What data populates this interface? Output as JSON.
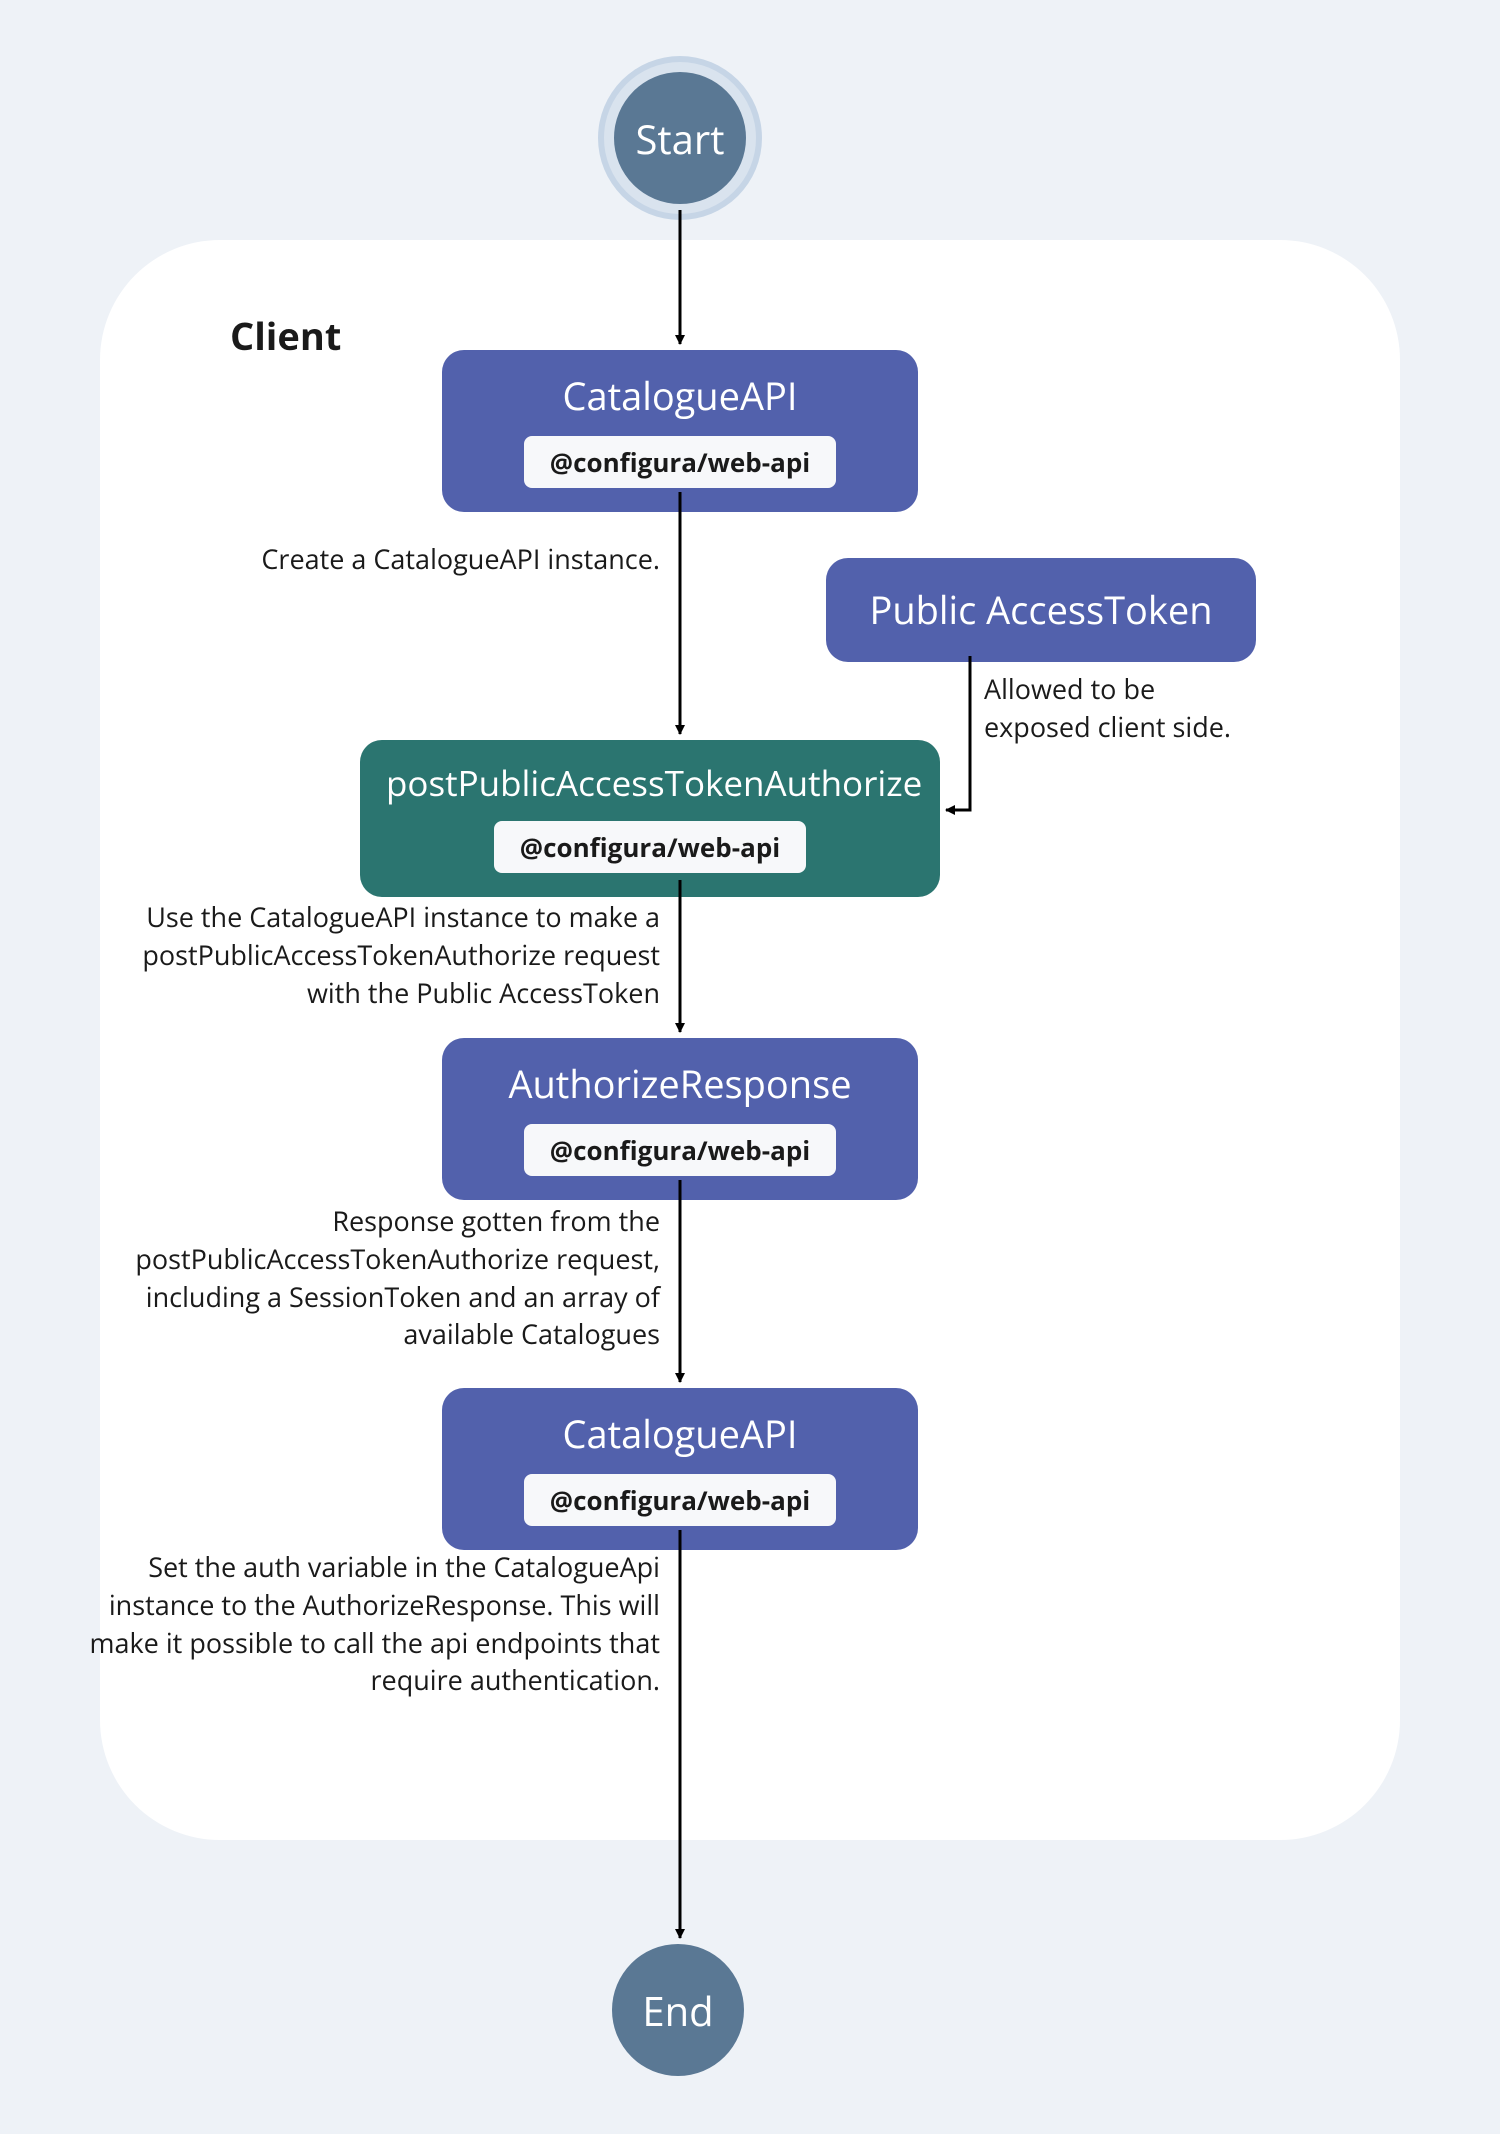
{
  "terminals": {
    "start": "Start",
    "end": "End"
  },
  "client_label": "Client",
  "boxes": {
    "catalogue_api_1": {
      "title": "CatalogueAPI",
      "tag": "@configura/web-api"
    },
    "public_token": {
      "title": "Public AccessToken"
    },
    "post_auth": {
      "title": "postPublicAccessTokenAuthorize",
      "tag": "@configura/web-api"
    },
    "auth_response": {
      "title": "AuthorizeResponse",
      "tag": "@configura/web-api"
    },
    "catalogue_api_2": {
      "title": "CatalogueAPI",
      "tag": "@configura/web-api"
    }
  },
  "captions": {
    "create_instance": "Create a CatalogueAPI instance.",
    "exposed_client": "Allowed to be\nexposed client side.",
    "use_instance": "Use the CatalogueAPI instance to make a\npostPublicAccessTokenAuthorize request\nwith the Public AccessToken",
    "response_gotten": "Response gotten from the\npostPublicAccessTokenAuthorize request,\nincluding a SessionToken and an array of\navailable Catalogues",
    "set_auth": "Set the auth variable in the CatalogueApi\ninstance to the AuthorizeResponse. This will\nmake it possible to call the api endpoints that\nrequire authentication."
  }
}
